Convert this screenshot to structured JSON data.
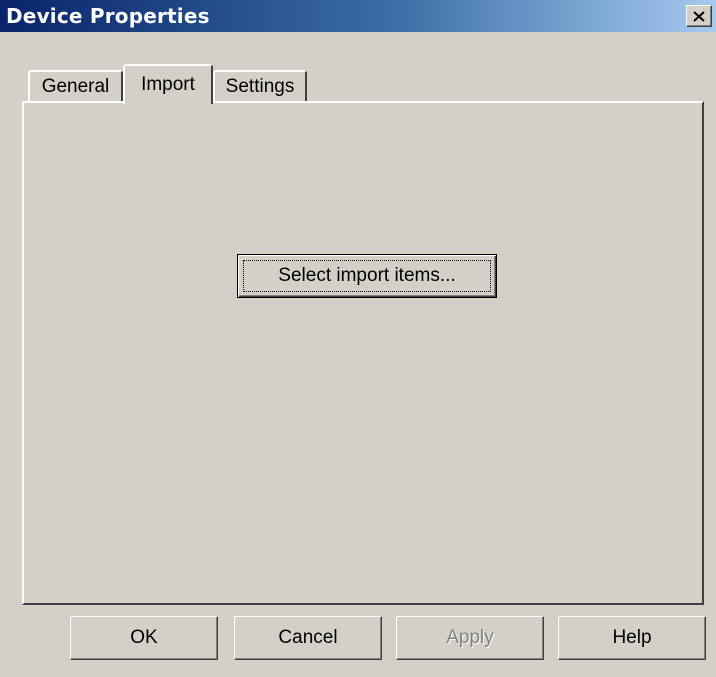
{
  "window": {
    "title": "Device Properties"
  },
  "tabs": [
    {
      "label": "General",
      "active": false
    },
    {
      "label": "Import",
      "active": true
    },
    {
      "label": "Settings",
      "active": false
    }
  ],
  "import_panel": {
    "select_button_label": "Select import items..."
  },
  "footer": {
    "ok_label": "OK",
    "cancel_label": "Cancel",
    "apply_label": "Apply",
    "help_label": "Help"
  },
  "colors": {
    "window_face": "#d4d0c8",
    "title_start": "#0a246a",
    "title_end": "#a6caf0",
    "disabled_text": "#808080"
  }
}
